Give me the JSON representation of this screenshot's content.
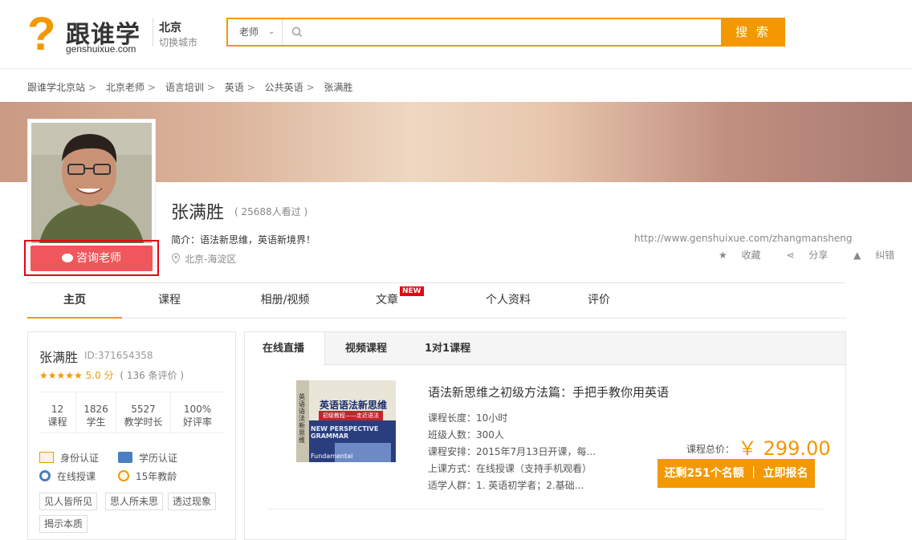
{
  "header": {
    "logo_mark": "?",
    "logo_cn": "跟谁学",
    "logo_en": "genshuixue.com",
    "city": "北京",
    "city_switch": "切换城市",
    "search": {
      "type_label": "老师",
      "placeholder": "",
      "button_label": "搜 索"
    }
  },
  "breadcrumb": [
    "跟谁学北京站",
    "北京老师",
    "语言培训",
    "英语",
    "公共英语",
    "张满胜"
  ],
  "breadcrumb_sep": ">",
  "profile": {
    "name": "张满胜",
    "views": "( 25688人看过 )",
    "intro": "简介：语法新思维，英语新境界！",
    "location": "北京-海淀区",
    "url": "http://www.genshuixue.com/zhangmansheng",
    "consult_label": "咨询老师",
    "actions": {
      "favorite": "收藏",
      "share": "分享",
      "report": "纠错"
    }
  },
  "nav_tabs": [
    {
      "label": "主页",
      "active": true
    },
    {
      "label": "课程"
    },
    {
      "label": "相册/视频"
    },
    {
      "label": "文章",
      "badge": "NEW"
    },
    {
      "label": "个人资料"
    },
    {
      "label": "评价"
    }
  ],
  "teacher_card": {
    "name": "张满胜",
    "id": "ID:371654358",
    "stars": "★★★★★",
    "score": "5.0 分",
    "reviews": "( 136 条评价 )",
    "stats": [
      {
        "value": "12",
        "label": "课程"
      },
      {
        "value": "1826",
        "label": "学生"
      },
      {
        "value": "5527",
        "label": "教学时长"
      },
      {
        "value": "100%",
        "label": "好评率"
      }
    ],
    "badges": [
      "身份认证",
      "学历认证",
      "在线授课",
      "15年教龄"
    ],
    "tags": [
      "见人皆所见",
      "思人所未思",
      "透过现象",
      "揭示本质"
    ]
  },
  "course_panel": {
    "tabs": [
      "在线直播",
      "视频课程",
      "1对1课程"
    ],
    "course": {
      "cover_title": "英语语法新思维",
      "cover_subtitle": "初级教程——走近语法",
      "cover_en": "NEW PERSPECTIVE GRAMMAR",
      "cover_en2": "Fundamental",
      "cover_spine": "英语语法新思维",
      "title": "语法新思维之初级方法篇：手把手教你用英语",
      "length": "课程长度：10小时",
      "class_size": "班级人数：300人",
      "schedule": "课程安排：2015年7月13日开课，每...",
      "mode": "上课方式：在线授课（支持手机观看）",
      "audience": "适学人群：1. 英语初学者；2.基础...",
      "total_label": "课程总价：",
      "price": "￥ 299.00",
      "enroll_label": "还剩251个名额 ｜ 立即报名"
    }
  },
  "colors": {
    "accent": "#f39800",
    "consult": "#f0575c",
    "highlight": "#e60012"
  }
}
